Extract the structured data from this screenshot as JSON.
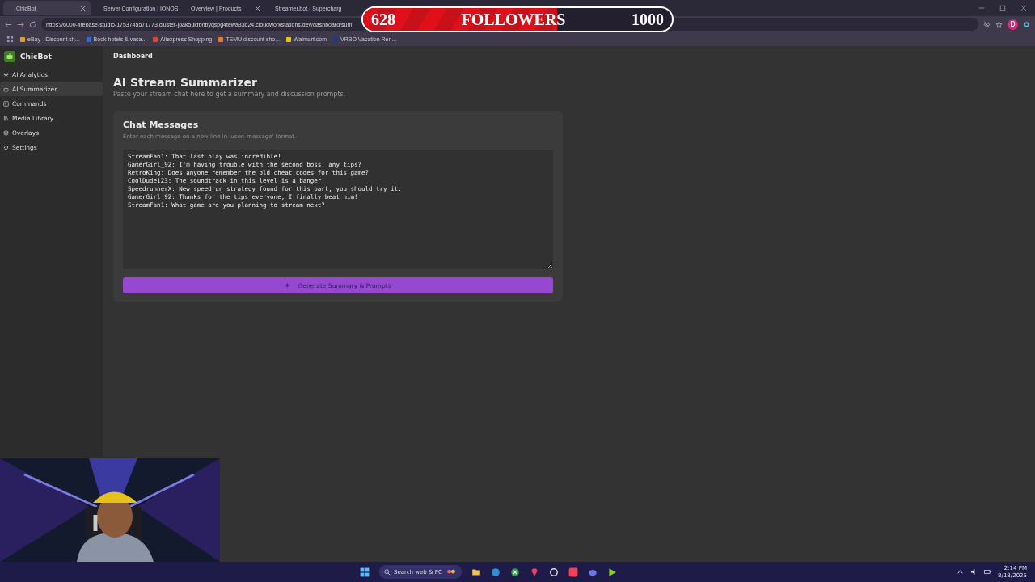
{
  "browser": {
    "tabs": [
      {
        "title": "ChicBot",
        "selected": true
      },
      {
        "title": "Server Configuration | IONOS",
        "selected": false
      },
      {
        "title": "Overview | Products",
        "selected": false
      },
      {
        "title": "Streamer.bot - Supercharg",
        "selected": false
      }
    ],
    "url": "https://6000-firebase-studio-1753745571773.cluster-joak5ukfbnbyqspg4tewa33d24.cloudworkstations.dev/dashboard/sum",
    "profile": "D",
    "bookmarks": [
      {
        "label": "eBay - Discount sh...",
        "color": "#e0a020"
      },
      {
        "label": "Book hotels & vaca...",
        "color": "#2f6bd6"
      },
      {
        "label": "Aliexpress Shopping",
        "color": "#e0452a"
      },
      {
        "label": "TEMU discount sho...",
        "color": "#f07a1a"
      },
      {
        "label": "Walmart.com",
        "color": "#f5c400"
      },
      {
        "label": "VRBO Vacation Ren...",
        "color": "#1d3a8a"
      }
    ]
  },
  "followers": {
    "count": "628",
    "label": "FOLLOWERS",
    "goal": "1000",
    "level": 0.628
  },
  "sidebar": {
    "brand": "ChicBot",
    "items": [
      {
        "label": "AI Analytics",
        "selected": false
      },
      {
        "label": "AI Summarizer",
        "selected": true
      },
      {
        "label": "Commands",
        "selected": false
      },
      {
        "label": "Media Library",
        "selected": false
      },
      {
        "label": "Overlays",
        "selected": false
      },
      {
        "label": "Settings",
        "selected": false
      }
    ]
  },
  "main": {
    "breadcrumb": "Dashboard",
    "title": "AI Stream Summarizer",
    "subtitle": "Paste your stream chat here to get a summary and discussion prompts.",
    "card": {
      "title": "Chat Messages",
      "hint": "Enter each message on a new line in 'user: message' format.",
      "value": "StreamFan1: That last play was incredible!\nGamerGirl_92: I'm having trouble with the second boss, any tips?\nRetroKing: Does anyone remember the old cheat codes for this game?\nCoolDude123: The soundtrack in this level is a banger.\nSpeedrunnerX: New speedrun strategy found for this part, you should try it.\nGamerGirl_92: Thanks for the tips everyone, I finally beat him!\nStreamFan1: What game are you planning to stream next?",
      "button": "Generate Summary & Prompts"
    }
  },
  "taskbar": {
    "search": "Search web & PC",
    "time": "2:14 PM",
    "date": "8/18/2025"
  }
}
